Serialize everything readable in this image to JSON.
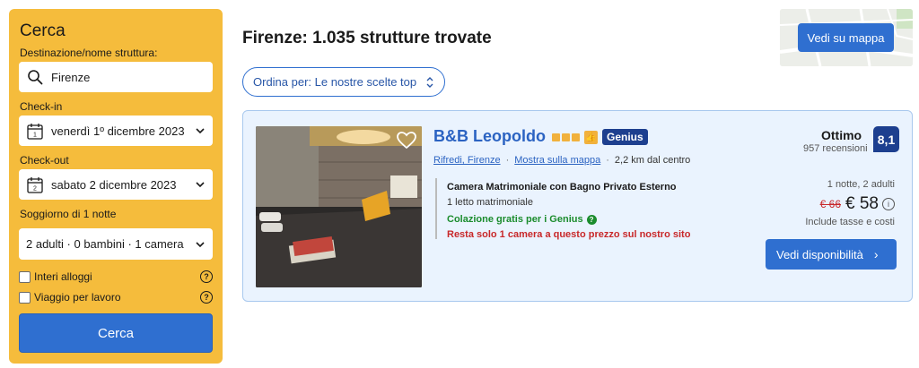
{
  "sidebar": {
    "title": "Cerca",
    "destination_label": "Destinazione/nome struttura:",
    "destination_value": "Firenze",
    "checkin_label": "Check-in",
    "checkin_value": "venerdì 1º dicembre 2023",
    "checkin_day": "1",
    "checkout_label": "Check-out",
    "checkout_value": "sabato 2 dicembre 2023",
    "checkout_day": "2",
    "stay_label": "Soggiorno di 1 notte",
    "guests_value": "2 adulti · 0 bambini · 1 camera",
    "checkbox_whole": "Interi alloggi",
    "checkbox_work": "Viaggio per lavoro",
    "help_symbol": "?",
    "search_button": "Cerca"
  },
  "header": {
    "results_title": "Firenze: 1.035 strutture trovate",
    "sort_label": "Ordina per: Le nostre scelte top",
    "map_button": "Vedi su mappa"
  },
  "property": {
    "name": "B&B Leopoldo",
    "stars": 3,
    "genius_badge": "Genius",
    "area_link": "Rifredi, Firenze",
    "map_link": "Mostra sulla mappa",
    "distance": "2,2 km dal centro",
    "room_title": "Camera Matrimoniale con Bagno Privato Esterno",
    "bed": "1 letto matrimoniale",
    "breakfast": "Colazione gratis per i Genius",
    "scarcity": "Resta solo 1 camera a questo prezzo sul nostro sito",
    "rating_word": "Ottimo",
    "reviews": "957 recensioni",
    "score": "8,1",
    "nights_guests": "1 notte, 2 adulti",
    "old_price": "€ 66",
    "price": "€ 58",
    "taxes": "Include tasse e costi",
    "availability_button": "Vedi disponibilità"
  },
  "colors": {
    "accent": "#2f6fd0",
    "sidebar_bg": "#f5bc3c",
    "genius": "#1d3f8f",
    "alert_red": "#c8282a",
    "green": "#1b8c2d"
  }
}
